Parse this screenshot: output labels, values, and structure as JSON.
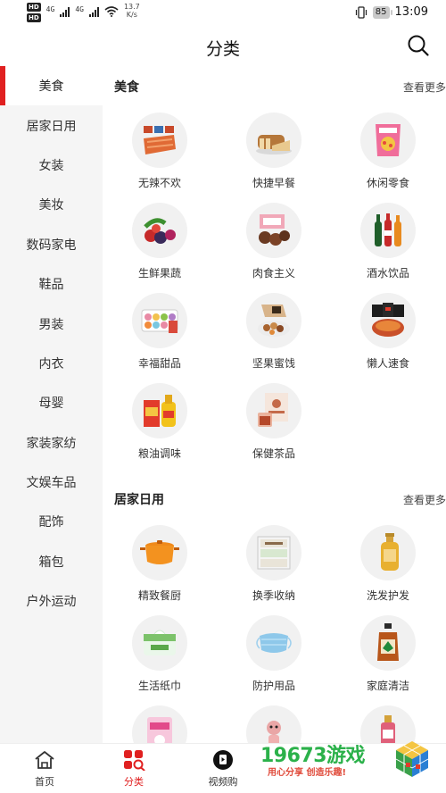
{
  "status_bar": {
    "sim1": "HD",
    "sim2": "HD",
    "net1": "4G",
    "net2": "4G",
    "speed_value": "13.7",
    "speed_unit": "K/s",
    "battery": "85",
    "time": "13:09"
  },
  "header": {
    "title": "分类"
  },
  "sidebar": {
    "items": [
      {
        "label": "美食"
      },
      {
        "label": "居家日用"
      },
      {
        "label": "女装"
      },
      {
        "label": "美妆"
      },
      {
        "label": "数码家电"
      },
      {
        "label": "鞋品"
      },
      {
        "label": "男装"
      },
      {
        "label": "内衣"
      },
      {
        "label": "母婴"
      },
      {
        "label": "家装家纺"
      },
      {
        "label": "文娱车品"
      },
      {
        "label": "配饰"
      },
      {
        "label": "箱包"
      },
      {
        "label": "户外运动"
      }
    ]
  },
  "sections": [
    {
      "title": "美食",
      "more": "查看更多",
      "items": [
        {
          "label": "无辣不欢",
          "icon": "spicy-snack-icon"
        },
        {
          "label": "快捷早餐",
          "icon": "bread-icon"
        },
        {
          "label": "休闲零食",
          "icon": "chips-bag-icon"
        },
        {
          "label": "生鲜果蔬",
          "icon": "berries-icon"
        },
        {
          "label": "肉食主义",
          "icon": "braised-meat-icon"
        },
        {
          "label": "酒水饮品",
          "icon": "drink-bottles-icon"
        },
        {
          "label": "幸福甜品",
          "icon": "macaron-box-icon"
        },
        {
          "label": "坚果蜜饯",
          "icon": "nuts-icon"
        },
        {
          "label": "懒人速食",
          "icon": "instant-noodles-icon"
        },
        {
          "label": "粮油调味",
          "icon": "cooking-oil-icon"
        },
        {
          "label": "保健茶品",
          "icon": "tea-box-icon"
        }
      ]
    },
    {
      "title": "居家日用",
      "more": "查看更多",
      "items": [
        {
          "label": "精致餐厨",
          "icon": "cooking-pot-icon"
        },
        {
          "label": "换季收纳",
          "icon": "storage-drawer-icon"
        },
        {
          "label": "洗发护发",
          "icon": "shampoo-bottle-icon"
        },
        {
          "label": "生活纸巾",
          "icon": "tissue-pack-icon"
        },
        {
          "label": "防护用品",
          "icon": "face-mask-icon"
        },
        {
          "label": "家庭清洁",
          "icon": "disinfectant-bottle-icon"
        },
        {
          "label": "",
          "icon": "sanitary-pad-icon"
        },
        {
          "label": "",
          "icon": "toy-figure-icon"
        },
        {
          "label": "",
          "icon": "cosmetic-bottle-icon"
        }
      ]
    }
  ],
  "bottom_nav": [
    {
      "label": "首页",
      "icon": "home-icon"
    },
    {
      "label": "分类",
      "icon": "category-icon"
    },
    {
      "label": "视频购",
      "icon": "video-shop-icon"
    }
  ],
  "watermark": {
    "brand": "19673游戏",
    "slogan": "用心分享 创造乐趣!"
  },
  "colors": {
    "accent": "#e02020",
    "sidebar_bg": "#f5f5f5"
  }
}
